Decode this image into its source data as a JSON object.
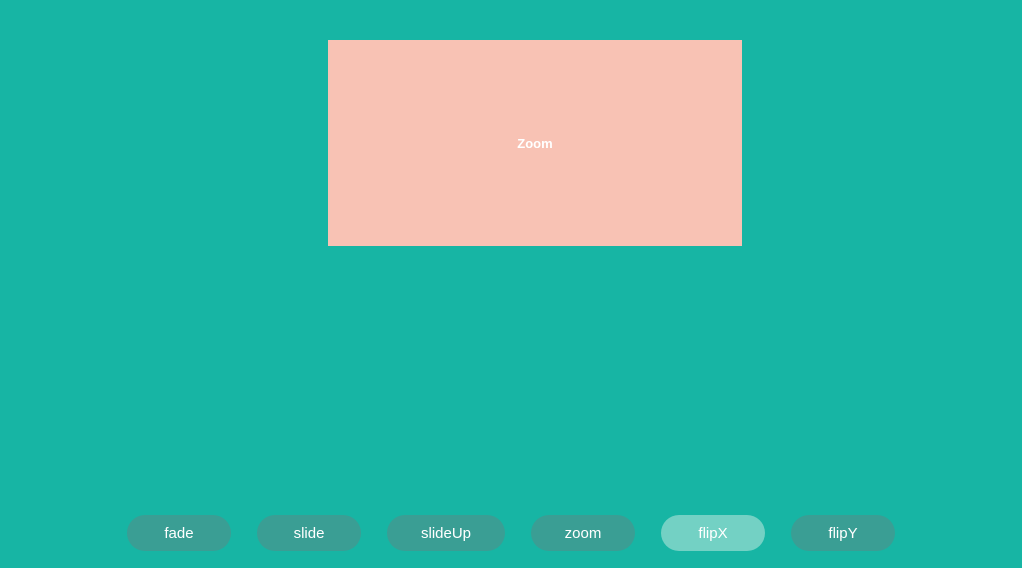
{
  "card": {
    "label": "Zoom"
  },
  "buttons": {
    "fade": "fade",
    "slide": "slide",
    "slideUp": "slideUp",
    "zoom": "zoom",
    "flipX": "flipX",
    "flipY": "flipY"
  }
}
